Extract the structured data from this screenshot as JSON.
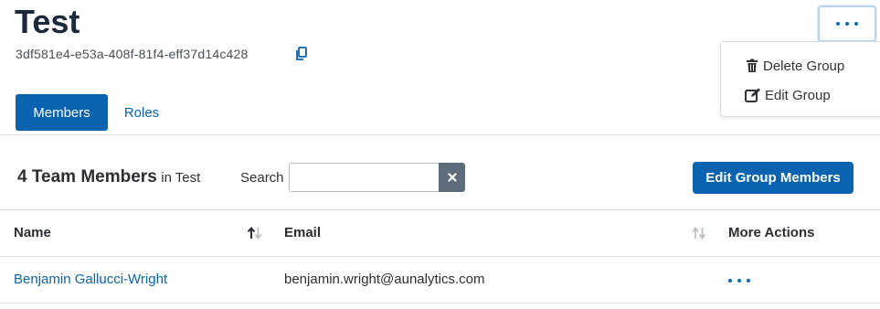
{
  "header": {
    "title": "Test",
    "group_id": "3df581e4-e53a-408f-81f4-eff37d14c428"
  },
  "menu": {
    "items": [
      {
        "label": "Delete Group",
        "icon": "trash-icon"
      },
      {
        "label": "Edit Group",
        "icon": "edit-icon"
      }
    ]
  },
  "tabs": [
    {
      "label": "Members",
      "active": true
    },
    {
      "label": "Roles",
      "active": false
    }
  ],
  "members_section": {
    "count_label": "4 Team Members",
    "context_label": "in Test",
    "search_label": "Search",
    "search_value": "",
    "edit_button_label": "Edit Group Members"
  },
  "table": {
    "columns": [
      "Name",
      "Email",
      "More Actions"
    ],
    "rows": [
      {
        "name": "Benjamin Gallucci-Wright",
        "email": "benjamin.wright@aunalytics.com"
      }
    ]
  },
  "colors": {
    "primary": "#0a63b0",
    "title": "#1b2a3a",
    "clear_button": "#5e6d7b"
  }
}
